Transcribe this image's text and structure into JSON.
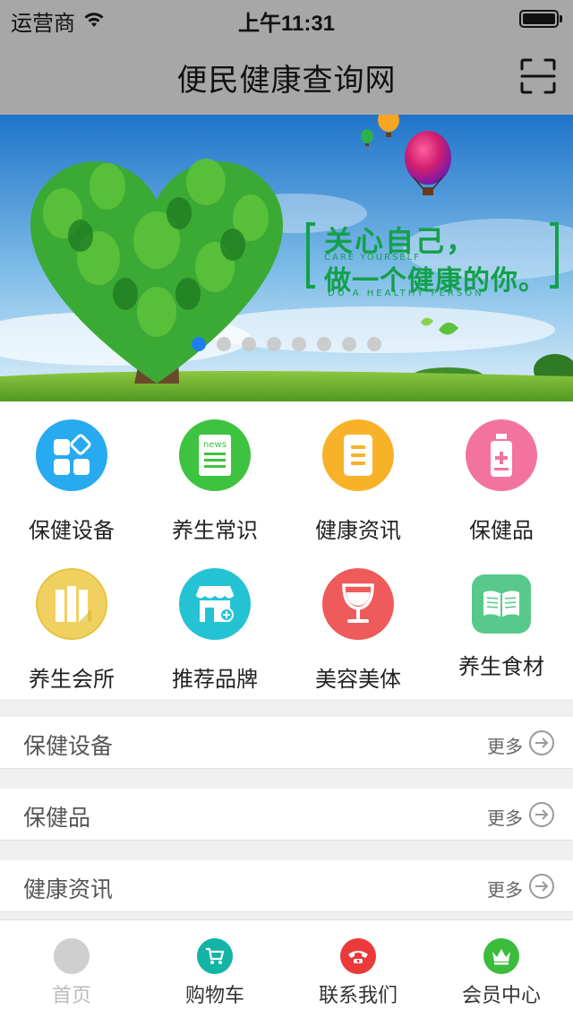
{
  "status_bar": {
    "carrier": "运营商",
    "time": "上午11:31"
  },
  "nav": {
    "title": "便民健康查询网",
    "scan_icon": "scan-icon"
  },
  "banner": {
    "headline_line1": "关心自己，",
    "headline_line2": "做一个健康的你。",
    "sub_en_top": "CARE YOURSELF",
    "sub_en_bottom": "DO A HEALTHY PERSON",
    "slide_count": 8,
    "active_slide": 1
  },
  "categories": [
    {
      "label": "保健设备",
      "icon": "grid-icon",
      "color": "#27aaf0"
    },
    {
      "label": "养生常识",
      "icon": "news-icon",
      "color": "#3dc33f"
    },
    {
      "label": "健康资讯",
      "icon": "document-icon",
      "color": "#f8b22a"
    },
    {
      "label": "保健品",
      "icon": "bottle-icon",
      "color": "#f2739e"
    },
    {
      "label": "养生会所",
      "icon": "building-icon",
      "color": "#f0d060"
    },
    {
      "label": "推荐品牌",
      "icon": "shop-icon",
      "color": "#24c3d4"
    },
    {
      "label": "美容美体",
      "icon": "wine-glass-icon",
      "color": "#ef5b5b"
    },
    {
      "label": "养生食材",
      "icon": "book-icon",
      "color": "#58c98b"
    }
  ],
  "sections": [
    {
      "title": "保健设备",
      "more": "更多"
    },
    {
      "title": "保健品",
      "more": "更多"
    },
    {
      "title": "健康资讯",
      "more": "更多"
    }
  ],
  "tabs": [
    {
      "label": "首页",
      "icon": "home-icon",
      "color": "#cfcfcf",
      "active": true
    },
    {
      "label": "购物车",
      "icon": "cart-icon",
      "color": "#13b3a5",
      "active": false
    },
    {
      "label": "联系我们",
      "icon": "phone-icon",
      "color": "#ea3a3a",
      "active": false
    },
    {
      "label": "会员中心",
      "icon": "crown-icon",
      "color": "#3bbd3b",
      "active": false
    }
  ]
}
